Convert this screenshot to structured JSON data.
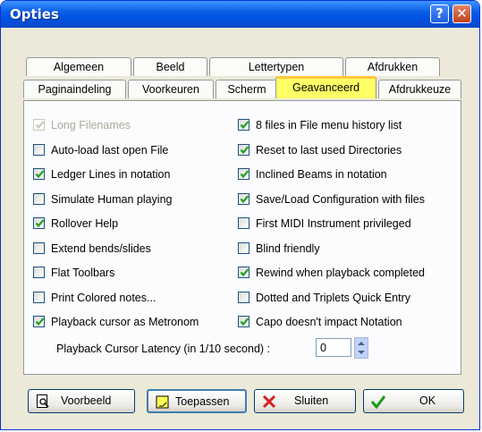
{
  "window": {
    "title": "Opties"
  },
  "tabs_row1": [
    "Algemeen",
    "Beeld",
    "Lettertypen",
    "Afdrukken"
  ],
  "tabs_row2": [
    "Paginaindeling",
    "Voorkeuren",
    "Scherm",
    "Geavanceerd",
    "Afdrukkeuze"
  ],
  "active_tab": "Geavanceerd",
  "options_left": [
    {
      "label": "Long Filenames",
      "checked": true,
      "disabled": true
    },
    {
      "label": "Auto-load last open File",
      "checked": false
    },
    {
      "label": "Ledger Lines in notation",
      "checked": true
    },
    {
      "label": "Simulate Human playing",
      "checked": false
    },
    {
      "label": "Rollover Help",
      "checked": true
    },
    {
      "label": "Extend bends/slides",
      "checked": false
    },
    {
      "label": "Flat Toolbars",
      "checked": false
    },
    {
      "label": "Print Colored notes...",
      "checked": false
    },
    {
      "label": "Playback cursor as Metronom",
      "checked": true
    }
  ],
  "options_right": [
    {
      "label": "8 files in File menu history list",
      "checked": true
    },
    {
      "label": "Reset to last used Directories",
      "checked": true
    },
    {
      "label": "Inclined Beams in notation",
      "checked": true
    },
    {
      "label": "Save/Load Configuration with files",
      "checked": true
    },
    {
      "label": "First MIDI Instrument privileged",
      "checked": false
    },
    {
      "label": "Blind friendly",
      "checked": false
    },
    {
      "label": "Rewind when playback completed",
      "checked": true
    },
    {
      "label": "Dotted and Triplets Quick Entry",
      "checked": false
    },
    {
      "label": "Capo doesn't impact Notation",
      "checked": true
    }
  ],
  "latency": {
    "label": "Playback Cursor Latency (in 1/10 second) :",
    "value": "0"
  },
  "buttons": {
    "preview": "Voorbeeld",
    "apply": "Toepassen",
    "close": "Sluiten",
    "ok": "OK"
  },
  "colors": {
    "titlebar": "#0054e3",
    "active_tab": "#ffff66",
    "checkmark": "#21a121"
  }
}
